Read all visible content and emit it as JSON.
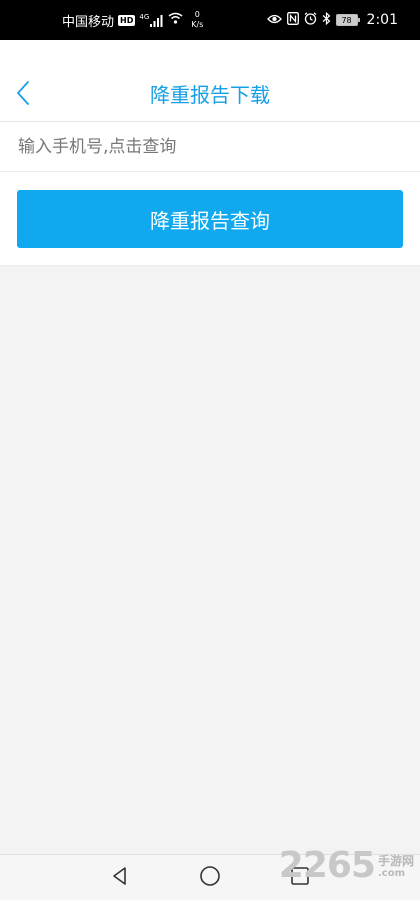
{
  "status_bar": {
    "carrier": "中国移动",
    "hd_badge": "HD",
    "network_type": "4G",
    "speed_value": "0",
    "speed_unit": "K/s",
    "battery": "78",
    "time": "2:01"
  },
  "header": {
    "title": "降重报告下载",
    "back_icon": "chevron-left-icon"
  },
  "search": {
    "placeholder": "输入手机号,点击查询",
    "value": ""
  },
  "actions": {
    "query_label": "降重报告查询"
  },
  "system_nav": {
    "back_icon": "triangle-back-icon",
    "home_icon": "circle-home-icon",
    "recents_icon": "square-recents-icon"
  },
  "watermark": {
    "number": "2265",
    "text_cn": "手游网",
    "domain": ".com"
  },
  "colors": {
    "accent": "#16a0e6",
    "button": "#10a9ef",
    "background": "#f3f3f3"
  }
}
